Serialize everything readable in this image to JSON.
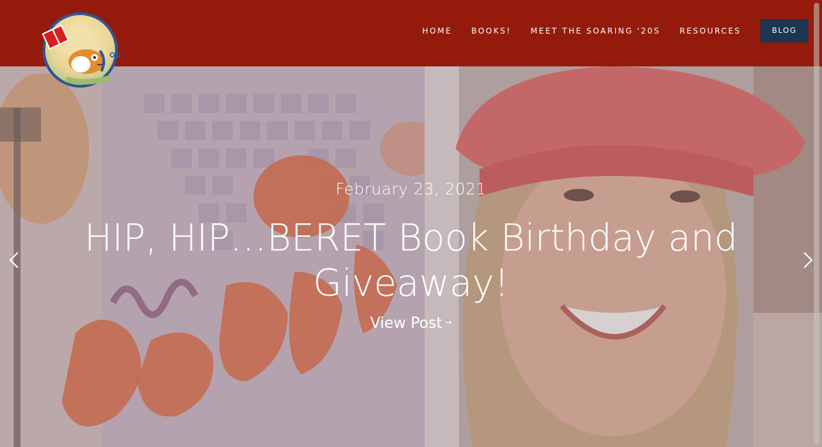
{
  "site": {
    "logo_icon": "guinea-pig-reading-book-logo"
  },
  "nav": {
    "items": [
      {
        "label": "HOME"
      },
      {
        "label": "BOOKS!"
      },
      {
        "label": "MEET THE SOARING '20S"
      },
      {
        "label": "RESOURCES"
      }
    ],
    "blog_label": "BLOG"
  },
  "hero": {
    "date": "February 23, 2021",
    "title": "HIP, HIP…BERET Book Birthday and Giveaway!",
    "view_post": "View Post",
    "view_post_arrow": "→",
    "prev_icon": "chevron-left-icon",
    "next_icon": "chevron-right-icon",
    "image_description_icon": "author-holding-book-photo"
  },
  "colors": {
    "header_bg": "#941b0c",
    "blog_button_bg": "#1b3552",
    "text": "#ffffff"
  }
}
